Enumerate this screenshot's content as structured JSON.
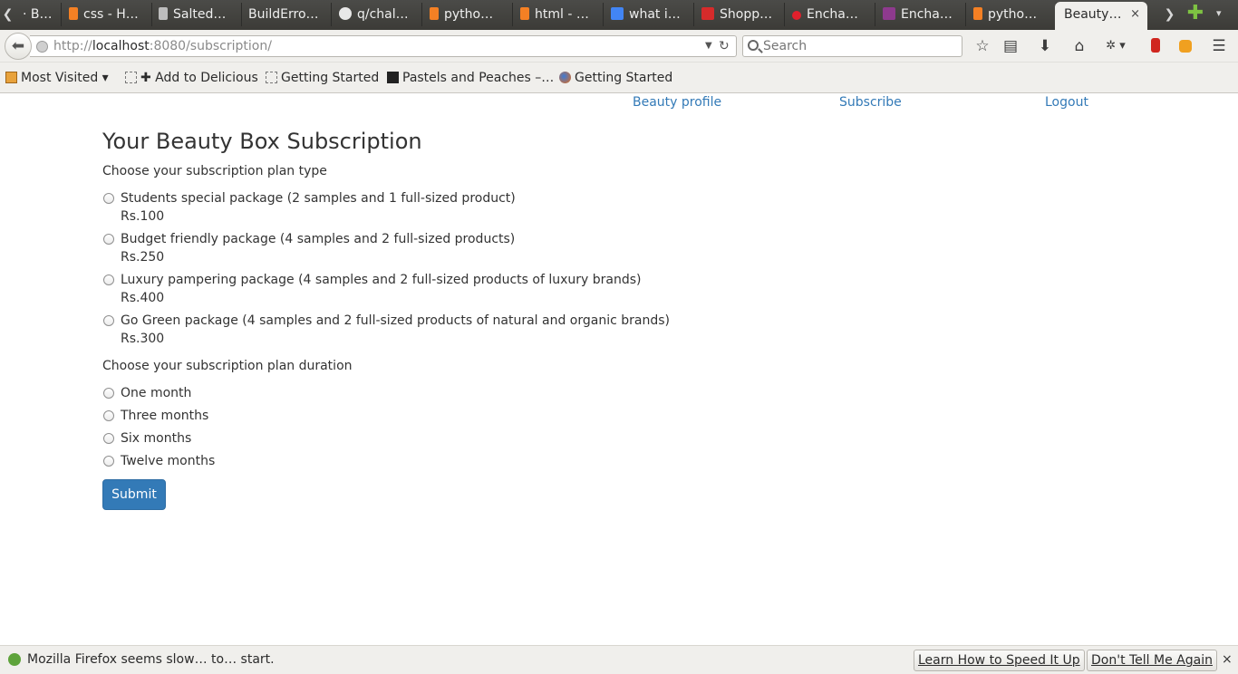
{
  "browser": {
    "tabs": [
      {
        "title": "· B…",
        "icon": "bug-icon",
        "color": "#9a9a9a"
      },
      {
        "title": "css - H…",
        "icon": "stackoverflow-icon",
        "color": "#f48024"
      },
      {
        "title": "Salted…",
        "icon": "phone-icon",
        "color": "#d0d0d0"
      },
      {
        "title": "BuildErro…",
        "icon": "blank-icon",
        "color": "transparent"
      },
      {
        "title": "q/chal…",
        "icon": "github-icon",
        "color": "#e8e8e8"
      },
      {
        "title": "pytho…",
        "icon": "stackoverflow-icon",
        "color": "#f48024"
      },
      {
        "title": "html - …",
        "icon": "stackoverflow-icon",
        "color": "#f48024"
      },
      {
        "title": "what i…",
        "icon": "google-icon",
        "color": "#4285f4"
      },
      {
        "title": "Shopp…",
        "icon": "heart-shop-icon",
        "color": "#d62b2b"
      },
      {
        "title": "Encha…",
        "icon": "heart-icon",
        "color": "#e0202c"
      },
      {
        "title": "Encha…",
        "icon": "script-e-icon",
        "color": "#8e3a8e"
      },
      {
        "title": "pytho…",
        "icon": "stackoverflow-icon",
        "color": "#f48024"
      }
    ],
    "active_tab": {
      "title": "Beauty…",
      "close": "×"
    },
    "new_tab": "✚",
    "url": {
      "prefix": "http://",
      "host": "localhost",
      "rest": ":8080/subscription/"
    },
    "search_placeholder": "Search",
    "toolbar_icons": [
      "star-icon",
      "reading-list-icon",
      "download-icon",
      "home-icon",
      "addon-icon",
      "pocket-icon",
      "fox-icon",
      "menu-icon"
    ]
  },
  "bookmarks": [
    {
      "label": "Most Visited ▾",
      "icon": "folder-icon"
    },
    {
      "label": "✚ Add to Delicious",
      "icon": "empty-icon"
    },
    {
      "label": "Getting Started",
      "icon": "empty-icon"
    },
    {
      "label": "Pastels and Peaches –…",
      "icon": "pastels-icon"
    },
    {
      "label": "Getting Started",
      "icon": "firefox-icon"
    }
  ],
  "page": {
    "nav": {
      "beauty_profile": "Beauty profile",
      "subscribe": "Subscribe",
      "logout": "Logout"
    },
    "title": "Your Beauty Box Subscription",
    "plan_type_label": "Choose your subscription plan type",
    "plans": [
      {
        "label": "Students special package (2 samples and 1 full-sized product)",
        "price": "Rs.100"
      },
      {
        "label": "Budget friendly package (4 samples and 2 full-sized products)",
        "price": "Rs.250"
      },
      {
        "label": "Luxury pampering package (4 samples and 2 full-sized products of luxury brands)",
        "price": "Rs.400"
      },
      {
        "label": "Go Green package (4 samples and 2 full-sized products of natural and organic brands)",
        "price": "Rs.300"
      }
    ],
    "duration_label": "Choose your subscription plan duration",
    "durations": [
      "One month",
      "Three months",
      "Six months",
      "Twelve months"
    ],
    "submit": "Submit",
    "link_color": "#337ab7",
    "button_color": "#337ab7"
  },
  "notification": {
    "text": "Mozilla Firefox seems slow… to… start.",
    "learn_button": "Learn How to Speed It Up",
    "dismiss_button": "Don't Tell Me Again",
    "close": "×"
  }
}
